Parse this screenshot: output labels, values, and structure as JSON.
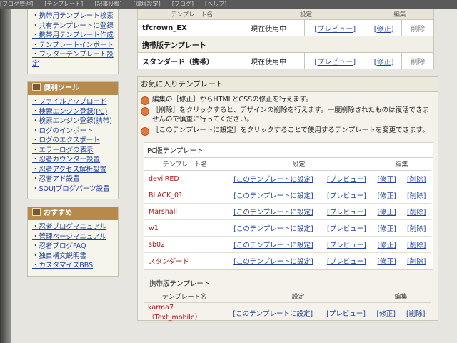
{
  "topbar": [
    "[ブログ管理]",
    "[テンプレート]",
    "[記事投稿]",
    "[環境設定]",
    "[ブログ]",
    "[ヘルプ]"
  ],
  "sidebar": {
    "top_links": [
      "携帯用テンプレート検索",
      "共有テンプレートに登録",
      "携帯用テンプレート作成",
      "テンプレートインポート",
      "フッターテンプレート設定"
    ],
    "tools_title": "便利ツール",
    "tools_links": [
      "ファイルアップロード",
      "検索エンジン登録(PC)",
      "検索エンジン登録(携帯)",
      "ログのインポート",
      "ログのエクスポート",
      "エラーログの表示",
      "忍者カウンター設置",
      "忍者アクセス解析設置",
      "忍者アド設置",
      "SOUJブログパーツ設置"
    ],
    "osusume_title": "おすすめ",
    "osusume_links": [
      "忍者ブログマニュアル",
      "管理ページマニュアル",
      "忍者ブログFAQ",
      "独自構文説明書",
      "カスタマイズBBS"
    ]
  },
  "current": {
    "col_name": "テンプレート名",
    "col_setting": "設定",
    "col_edit": "編集",
    "pc_row": {
      "name": "tfcrown_EX",
      "status": "現在使用中",
      "preview": "[プレビュー]",
      "edit": "[修正]",
      "delete": "削除"
    },
    "mobile_label": "携帯版テンプレート",
    "mobile_row": {
      "name": "スタンダード（携帯）",
      "status": "現在使用中",
      "preview": "[プレビュー]",
      "edit": "[修正]",
      "delete": "削除"
    }
  },
  "favorites": {
    "title": "お気に入りテンプレート",
    "notes": [
      "編集の［修正］からHTMLとCSSの修正を行えます。",
      "［削除］をクリックすると、デザインの削除を行えます。一度削除されたものは復活できませんので慎重に行ってください。",
      "［このテンプレートに設定］をクリックすることで使用するテンプレートを変更できます。"
    ],
    "pc_title": "PC版テンプレート",
    "col_name": "テンプレート名",
    "col_setting": "設定",
    "col_edit": "編集",
    "set_label": "[このテンプレートに設定]",
    "preview_label": "[プレビュー]",
    "edit_label": "[修正]",
    "delete_label": "[削除]",
    "pc_templates": [
      {
        "name": "devilRED"
      },
      {
        "name": "BLACK_01"
      },
      {
        "name": "Marshall"
      },
      {
        "name": "w1"
      },
      {
        "name": "sb02"
      },
      {
        "name": "スタンダード"
      }
    ],
    "mobile_title": "携帯版テンプレート",
    "mobile_templates": [
      {
        "name": "karma7 （Text_mobile）"
      }
    ]
  },
  "colors": {
    "sidebar_header": "#b78a4c",
    "link": "#1f3fa0",
    "template_name": "#b01818",
    "note_bullet": "#e0793a"
  }
}
